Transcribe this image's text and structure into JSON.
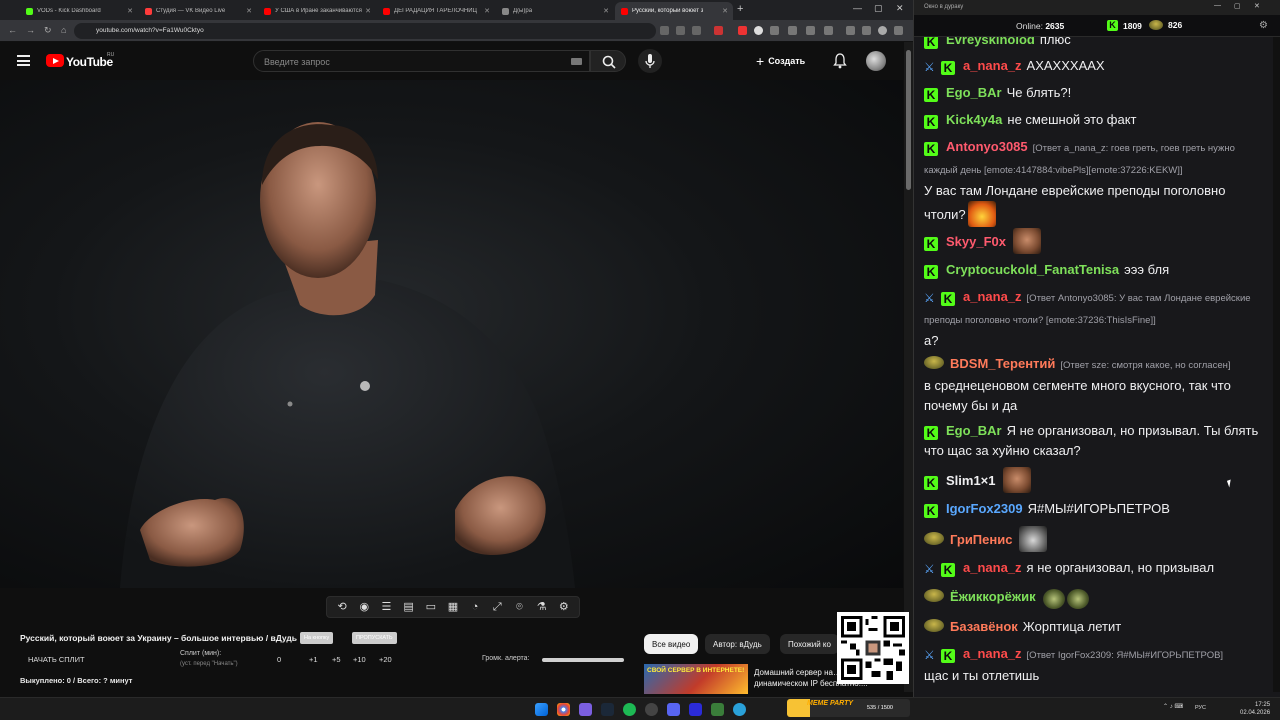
{
  "browser": {
    "tabs": [
      {
        "title": "VODs - Kick Dashboard",
        "color": "#53fc18"
      },
      {
        "title": "Студия — VK Видео Live",
        "color": "#ff3b3b"
      },
      {
        "title": "У США в Иране заканчиваются",
        "color": "#ff0000"
      },
      {
        "title": "ДЕГРАДАЦИЯ ТАРЕЛОЧНИЦ",
        "color": "#ff0000"
      },
      {
        "title": "Д(ы)ра",
        "color": "#888888"
      },
      {
        "title": "Русский, который воюет з",
        "color": "#ff0000"
      }
    ],
    "url": "youtube.com/watch?v=Fa1Wu0Cktyo"
  },
  "youtube": {
    "logo_text": "YouTube",
    "region": "RU",
    "search_placeholder": "Введите запрос",
    "create_label": "Создать"
  },
  "video": {
    "title": "Русский, который воюет за Украину – большое интервью / вДудь",
    "btn_not_important": "На кнопку",
    "btn_skip": "ПРОПУСКАТЬ"
  },
  "controls": {
    "start_split": "НАЧАТЬ СПЛИТ",
    "split_label": "Сплит (мин):",
    "split_hint": "(уст. перед \"Начать\")",
    "split_values": [
      "0",
      "+1",
      "+5",
      "+10",
      "+20"
    ],
    "volume_label": "Громк. алерта:",
    "volume_level": 1.0,
    "bought": "Выкуплено: 0 / Всего: ? минут"
  },
  "chips": [
    "Все видео",
    "Автор: вДудь",
    "Похожий ко"
  ],
  "recommended": {
    "thumb_text": "СВОЙ СЕРВЕР В ИНТЕРНЕТЕ!",
    "title": "Домашний сервер на… динамическом IP бесплатно!..."
  },
  "chat": {
    "window_title": "Окно в дураку",
    "online_label": "Online:",
    "online_count": "2635",
    "kick_count": "1809",
    "points_count": "826",
    "messages": [
      {
        "badge": "kick",
        "user": "Evreyskinolod",
        "color": "#7ee05a",
        "text": "плюс"
      },
      {
        "badge": "sword-kick",
        "user": "a_nana_z",
        "color": "#ff4b4b",
        "text": "АХАХХХААХ"
      },
      {
        "badge": "kick",
        "user": "Ego_BAr",
        "color": "#7ee05a",
        "text": "Че блять?!"
      },
      {
        "badge": "kick",
        "user": "Kick4y4a",
        "color": "#7ee05a",
        "text": "не смешной это факт"
      },
      {
        "badge": "kick",
        "user": "Antonyo3085",
        "color": "#ff5a6e",
        "reply": "[Ответ a_nana_z: гоев греть, гоев греть нужно каждый день [emote:4147884:vibePls][emote:37226:KEKW]]",
        "text": "У вас там Лондане еврейские преподы поголовно чтоли?",
        "emote": "fire"
      },
      {
        "badge": "kick",
        "user": "Skyy_F0x",
        "color": "#ff5a6e",
        "text": "",
        "emote": "face"
      },
      {
        "badge": "kick",
        "user": "Cryptocuckold_FanatTenisa",
        "color": "#7ee05a",
        "text": "эээ бля"
      },
      {
        "badge": "sword-kick",
        "user": "a_nana_z",
        "color": "#ff4b4b",
        "reply": "[Ответ Antonyo3085: У вас там Лондане еврейские преподы поголовно чтоли? [emote:37236:ThisIsFine]]",
        "text": "а?"
      },
      {
        "badge": "pepe",
        "user": "BDSM_Терентий",
        "color": "#ff7a5a",
        "reply": "[Ответ sze: смотря какое, но согласен]",
        "text": "в среднеценовом сегменте много вкусного, так что почему бы и да"
      },
      {
        "badge": "kick",
        "user": "Ego_BAr",
        "color": "#7ee05a",
        "text": "Я не организовал, но призывал. Ты блять что щас за хуйню сказал?"
      },
      {
        "badge": "kick",
        "user": "Slim1×1",
        "color": "#efeff1",
        "text": "",
        "emote": "face"
      },
      {
        "badge": "kick",
        "user": "IgorFox2309",
        "color": "#5aa8ff",
        "text": "Я#МЫ#ИГОРЬПЕТРОВ"
      },
      {
        "badge": "pepe",
        "user": "ГриПенис",
        "color": "#ff7a5a",
        "text": "",
        "emote": "pepe"
      },
      {
        "badge": "sword-kick",
        "user": "a_nana_z",
        "color": "#ff4b4b",
        "text": "я не организовал, но призывал"
      },
      {
        "badge": "pepe",
        "user": "Ёжиккорёжик",
        "color": "#7ee05a",
        "text": "",
        "emote": "egg"
      },
      {
        "badge": "pepe",
        "user": "Базавёнок",
        "color": "#ff7a5a",
        "text": "Жорптица летит"
      },
      {
        "badge": "sword-kick",
        "user": "a_nana_z",
        "color": "#ff4b4b",
        "reply": "[Ответ IgorFox2309: Я#МЫ#ИГОРЬПЕТРОВ]",
        "text": "щас и ты отлетишь"
      }
    ]
  },
  "taskbar": {
    "twitch_logo": "MEME PARTY",
    "twitch_progress": "535 / 1500",
    "lang": "РУС",
    "time": "17:25",
    "date": "02.04.2026"
  }
}
